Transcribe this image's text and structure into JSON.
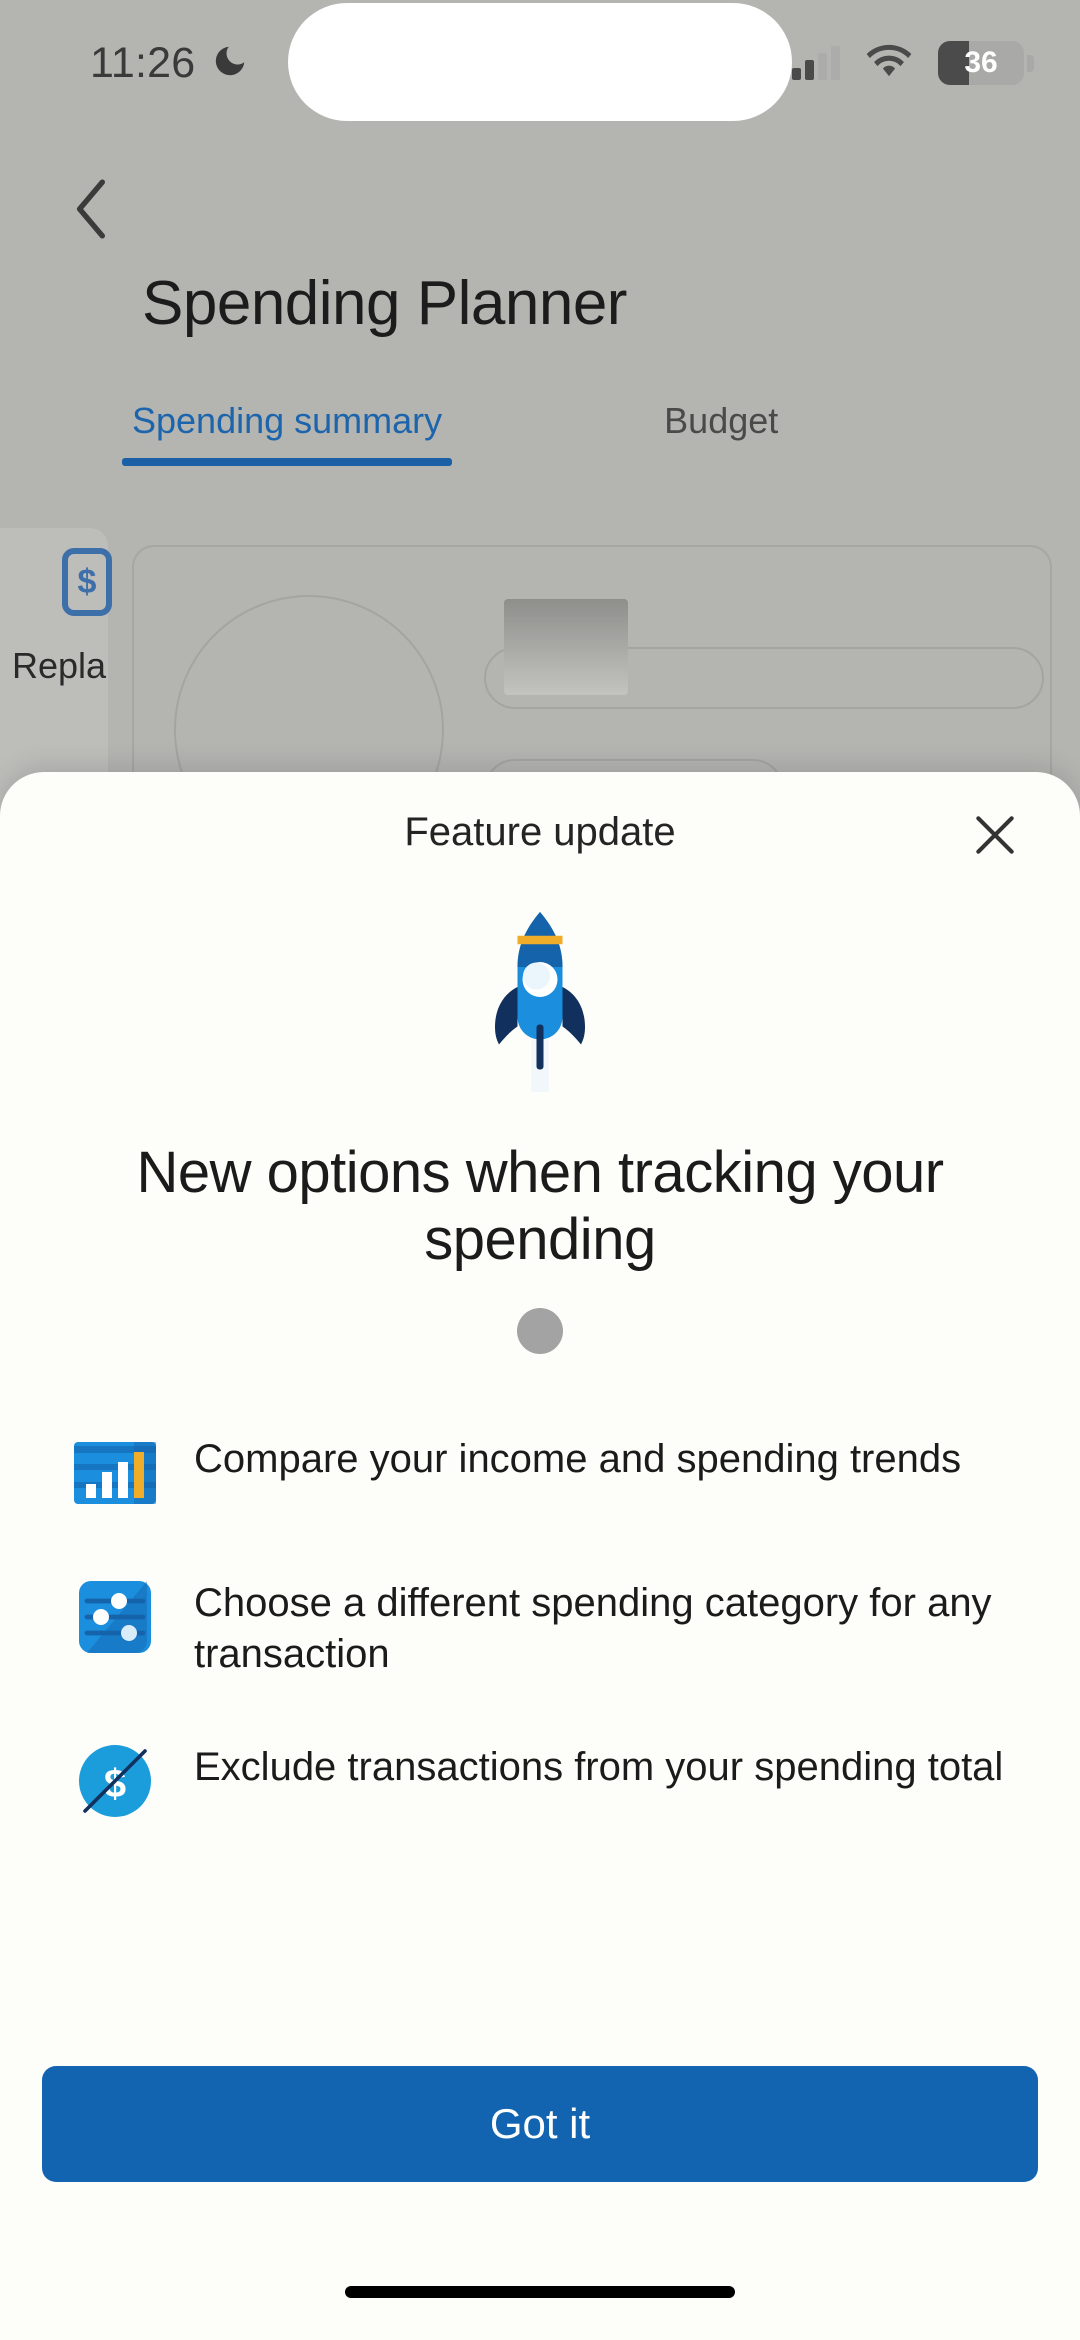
{
  "status_bar": {
    "time": "11:26",
    "dnd_icon": "moon-icon",
    "signal_icon": "signal-bars-icon",
    "signal_bars_filled": 2,
    "signal_bars_total": 4,
    "wifi_icon": "wifi-icon",
    "battery_level": "36",
    "battery_icon": "battery-icon"
  },
  "app": {
    "back_icon": "chevron-left-icon",
    "title": "Spending Planner",
    "tabs": [
      {
        "label": "Spending summary",
        "active": true
      },
      {
        "label": "Budget",
        "active": false
      }
    ],
    "side_card": {
      "icon": "card-icon",
      "icon_glyph": "$",
      "label": "Repla"
    }
  },
  "modal": {
    "title": "Feature update",
    "close_icon": "close-icon",
    "illustration_icon": "rocket-icon",
    "headline": "New options when tracking your spending",
    "pagination": {
      "dots": 1,
      "active_index": 0,
      "color": "#a3a3a3"
    },
    "features": [
      {
        "icon": "bar-chart-icon",
        "text": "Compare your income and spending trends"
      },
      {
        "icon": "sliders-icon",
        "text": "Choose a different spending category for any transaction"
      },
      {
        "icon": "dollar-slash-icon",
        "text": "Exclude transactions from your spending total"
      }
    ],
    "cta_label": "Got it"
  },
  "colors": {
    "accent_blue": "#1263b0",
    "tab_active_blue": "#1b5fa6",
    "icon_blue": "#1b8ede",
    "icon_blue_dark": "#1463ab",
    "icon_gold": "#f0ad2a",
    "rocket_navy": "#12305e",
    "backdrop_gray": "#b4b4b1",
    "sheet_bg": "#fdfdf9"
  }
}
